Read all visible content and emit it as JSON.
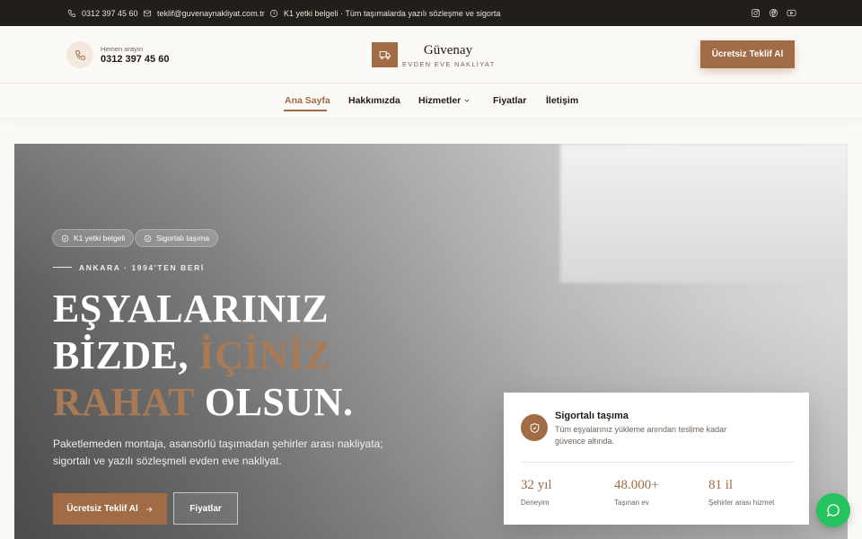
{
  "topbar": {
    "phone": "0312 397 45 60",
    "email": "teklif@guvenaynakliyat.com.tr",
    "notice": "K1 yetki belgeli · Tüm taşımalarda yazılı sözleşme ve sigorta",
    "social": [
      "instagram-icon",
      "facebook-icon",
      "youtube-icon"
    ]
  },
  "header": {
    "call_small": "Hemen arayın",
    "call_number": "0312 397 45 60",
    "logo_name": "Güvenay",
    "logo_tagline": "EVDEN EVE NAKLİYAT",
    "cta": "Ücretsiz Teklif Al"
  },
  "nav": {
    "items": [
      {
        "label": "Ana Sayfa",
        "active": true
      },
      {
        "label": "Hakkımızda"
      },
      {
        "label": "Hizmetler",
        "dropdown": true
      },
      {
        "label": "Fiyatlar"
      },
      {
        "label": "İletişim"
      }
    ]
  },
  "hero": {
    "badges": [
      "K1 yetki belgeli",
      "Sigortalı taşıma"
    ],
    "eyebrow": "ANKARA · 1994'TEN BERİ",
    "headline": {
      "line1": "EŞYALARINIZ",
      "line2_a": "BİZDE, ",
      "line2_b": "İÇİNİZ",
      "line3_a": "RAHAT",
      "line3_b": " OLSUN."
    },
    "description": "Paketlemeden montaja, asansörlü taşımadan şehirler arası nakliyata; sigortalı ve yazılı sözleşmeli evden eve nakliyat.",
    "primary_button": "Ücretsiz Teklif Al",
    "secondary_button": "Fiyatlar"
  },
  "card": {
    "title": "Sigortalı taşıma",
    "description": "Tüm eşyalarınız yükleme anından teslime kadar güvence altında.",
    "stats": [
      {
        "value": "32 yıl",
        "label": "Deneyim"
      },
      {
        "value": "48.000+",
        "label": "Taşınan ev"
      },
      {
        "value": "81 il",
        "label": "Şehirler arası hizmet"
      }
    ]
  },
  "colors": {
    "accent": "#a06b45",
    "topbar_bg": "#231e1a",
    "whatsapp": "#25c35d"
  }
}
